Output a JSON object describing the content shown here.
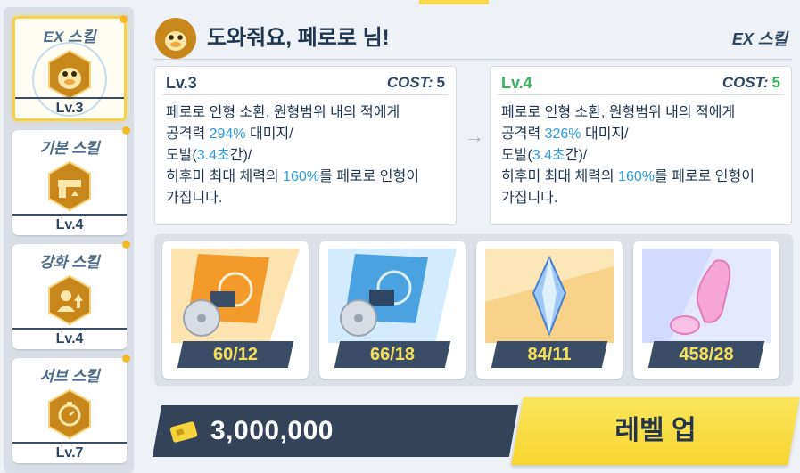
{
  "sidebar": {
    "tabs": [
      {
        "name": "EX 스킬",
        "level": "Lv.3",
        "icon": "duck-icon",
        "active": true
      },
      {
        "name": "기본 스킬",
        "level": "Lv.4",
        "icon": "gun-icon",
        "active": false
      },
      {
        "name": "강화 스킬",
        "level": "Lv.4",
        "icon": "character-upgrade-icon",
        "active": false
      },
      {
        "name": "서브 스킬",
        "level": "Lv.7",
        "icon": "cost-timer-icon",
        "active": false
      }
    ]
  },
  "header": {
    "icon": "duck-icon",
    "title": "도와줘요, 페로로 님!",
    "skill_type": "EX 스킬"
  },
  "current": {
    "level": "Lv.3",
    "cost_label": "COST:",
    "cost_value": "5",
    "desc": {
      "l1": "페로로 인형 소환, 원형범위 내의 적에게",
      "l2a": "공격력 ",
      "l2b": "294%",
      "l2c": " 대미지/",
      "l3a": "도발(",
      "l3b": "3.4초",
      "l3c": "간)/",
      "l4a": "히후미 최대 체력의 ",
      "l4b": "160%",
      "l4c": "를 페로로 인형이",
      "l5": "가집니다."
    }
  },
  "next": {
    "level": "Lv.4",
    "cost_label": "COST:",
    "cost_value": "5",
    "desc": {
      "l1": "페로로 인형 소환, 원형범위 내의 적에게",
      "l2a": "공격력 ",
      "l2b": "326%",
      "l2c": " 대미지/",
      "l3a": "도발(",
      "l3b": "3.4초",
      "l3c": "간)/",
      "l4a": "히후미 최대 체력의 ",
      "l4b": "160%",
      "l4c": "를 페로로 인형이",
      "l5": "가집니다."
    }
  },
  "arrow_icon": "arrow-right-icon",
  "materials": [
    {
      "icon": "ex-skill-disc-orange-icon",
      "count": "60/12"
    },
    {
      "icon": "ex-skill-disc-blue-icon",
      "count": "66/18"
    },
    {
      "icon": "blue-crystal-icon",
      "count": "84/11"
    },
    {
      "icon": "pink-artifact-icon",
      "count": "458/28"
    }
  ],
  "credits": {
    "icon": "credit-card-icon",
    "amount": "3,000,000"
  },
  "level_up_label": "레벨 업",
  "colors": {
    "accent_yellow": "#f6d530",
    "highlight_blue": "#2a9ae8",
    "next_green": "#39b25f",
    "dark_navy": "#34435a"
  }
}
